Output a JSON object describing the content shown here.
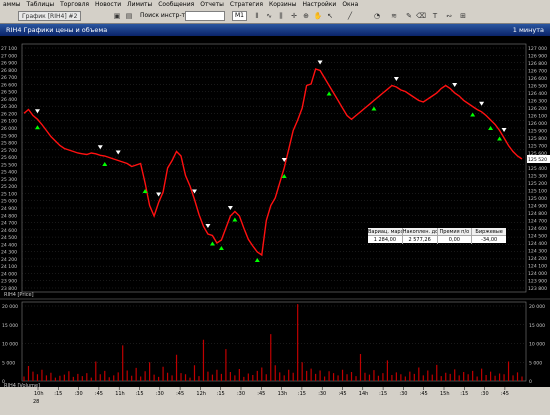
{
  "menu": [
    "аммы",
    "Таблицы",
    "Торговля",
    "Новости",
    "Лимиты",
    "Сообщения",
    "Отчеты",
    "Стратегия",
    "Корзины",
    "Настройки",
    "Окна"
  ],
  "toolbar": {
    "tab_label": "График [RIH4] #2",
    "search_label": "Поиск инстр-та",
    "search_value": "",
    "timeframe": "M1"
  },
  "window": {
    "title": "RIH4 Графики цены и объема",
    "timeframe_label": "1 минута"
  },
  "price_panel": {
    "label": "RIH4 [Price]",
    "left_ticks": [
      "27 100",
      "27 000",
      "26 900",
      "26 800",
      "26 700",
      "26 600",
      "26 500",
      "26 400",
      "26 300",
      "26 200",
      "26 100",
      "26 000",
      "25 900",
      "25 800",
      "25 700",
      "25 600",
      "25 500",
      "25 400",
      "25 300",
      "25 200",
      "25 100",
      "25 000",
      "24 900",
      "24 800",
      "24 700",
      "24 600",
      "24 500",
      "24 400",
      "24 300",
      "24 200",
      "24 100",
      "24 000",
      "23 900",
      "23 800"
    ],
    "right_ticks": [
      "127 000",
      "126 900",
      "126 800",
      "126 700",
      "126 600",
      "126 500",
      "126 400",
      "126 300",
      "126 200",
      "126 100",
      "126 000",
      "125 900",
      "125 800",
      "125 700",
      "125 600",
      "125 500",
      "125 400",
      "125 300",
      "125 200",
      "125 100",
      "125 000",
      "124 900",
      "124 800",
      "124 700",
      "124 600",
      "124 500",
      "124 400",
      "124 300",
      "124 200",
      "124 100",
      "124 000",
      "123 900",
      "123 800"
    ],
    "last_price_label": "125 520"
  },
  "volume_panel": {
    "label": "RIH4 [Volume]",
    "ticks": [
      "20 000",
      "15 000",
      "10 000",
      "5 000",
      "0"
    ]
  },
  "time_axis": {
    "labels": [
      "10h",
      ":15",
      ":30",
      ":45",
      "11h",
      ":15",
      ":30",
      ":45",
      "12h",
      ":15",
      ":30",
      ":45",
      "13h",
      ":15",
      ":30",
      ":45",
      "14h",
      ":15",
      ":30",
      ":45",
      "15h",
      ":15",
      ":30",
      ":45"
    ],
    "sub_label": "28"
  },
  "popup": {
    "headers": [
      "Вариац. маржа",
      "Накоплен. доход",
      "Премия п/о",
      "Биржевые"
    ],
    "values": [
      "1 284,00",
      "2 577,26",
      "0,00",
      "-34,00"
    ]
  },
  "colors": {
    "price_line": "#ff1010",
    "grid": "#404040",
    "buy_marker": "#00ff00",
    "sell_marker": "#ffffff",
    "volume_bar": "#c00000"
  },
  "chart_data": {
    "type": "line",
    "price_series": [
      126130,
      126180,
      126100,
      126050,
      125980,
      125900,
      125820,
      125760,
      125700,
      125660,
      125640,
      125620,
      125600,
      125590,
      125580,
      125600,
      125590,
      125570,
      125560,
      125540,
      125520,
      125500,
      125480,
      125460,
      125420,
      125440,
      125460,
      125200,
      124900,
      124760,
      124940,
      125080,
      125400,
      125500,
      125620,
      125560,
      125300,
      125160,
      124980,
      124780,
      124620,
      124520,
      124500,
      124400,
      124440,
      124600,
      124760,
      124820,
      124760,
      124600,
      124450,
      124360,
      124280,
      124240,
      124700,
      124900,
      125000,
      125200,
      125400,
      125650,
      125900,
      126040,
      126200,
      126500,
      126520,
      126720,
      126700,
      126600,
      126500,
      126400,
      126300,
      126200,
      126100,
      126050,
      126100,
      126150,
      126200,
      126250,
      126300,
      126350,
      126400,
      126450,
      126500,
      126480,
      126440,
      126420,
      126380,
      126340,
      126300,
      126280,
      126320,
      126360,
      126400,
      126460,
      126500,
      126460,
      126400,
      126360,
      126300,
      126260,
      126220,
      126180,
      126150,
      126100,
      126040,
      125980,
      125900,
      125800,
      125700,
      125620,
      125560,
      125520
    ],
    "volume_series": [
      1200,
      4000,
      2500,
      1800,
      3000,
      1500,
      2200,
      900,
      1400,
      1700,
      2600,
      1100,
      1900,
      1300,
      2100,
      900,
      5200,
      1800,
      2700,
      1000,
      1500,
      2300,
      9500,
      2800,
      1400,
      3500,
      1200,
      2600,
      5000,
      1700,
      1100,
      3800,
      2200,
      1500,
      7000,
      2100,
      1800,
      900,
      4200,
      1300,
      11000,
      2500,
      1700,
      3000,
      1900,
      8500,
      2400,
      1500,
      3200,
      1100,
      2000,
      1600,
      2700,
      3600,
      1800,
      12500,
      4200,
      2300,
      1500,
      3000,
      2200,
      20500,
      5000,
      2700,
      3300,
      1900,
      2800,
      1200,
      2600,
      2100,
      1500,
      3000,
      1800,
      2400,
      1300,
      7200,
      2200,
      1700,
      2900,
      1400,
      2100,
      5500,
      1600,
      2300,
      1800,
      1200,
      2500,
      1900,
      3600,
      1500,
      2800,
      1700,
      4300,
      1300,
      2200,
      1900,
      3100,
      1500,
      2400,
      1800,
      2700,
      1200,
      3300,
      1600,
      2500,
      1400,
      2000,
      1800,
      5200,
      1500,
      2300,
      1200
    ]
  }
}
